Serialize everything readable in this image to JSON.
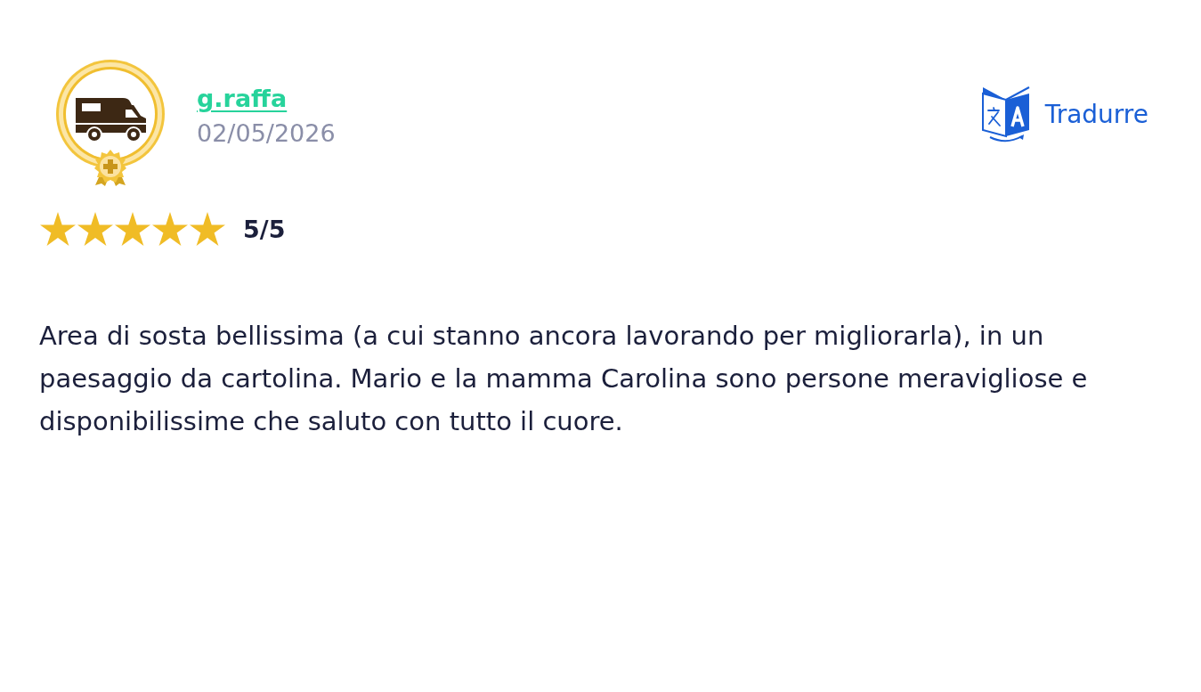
{
  "review": {
    "author": {
      "name": "g.raffa",
      "date": "02/05/2026"
    },
    "translate_button": {
      "label": "Tradurre"
    },
    "rating": {
      "stars": 5,
      "text": "5/5"
    },
    "text": "Area di sosta bellissima (a cui stanno ancora lavorando per migliorarla), in un paesaggio da cartolina. Mario e la mamma Carolina sono persone meravigliose e disponibilissime che saluto con tutto il cuore."
  }
}
